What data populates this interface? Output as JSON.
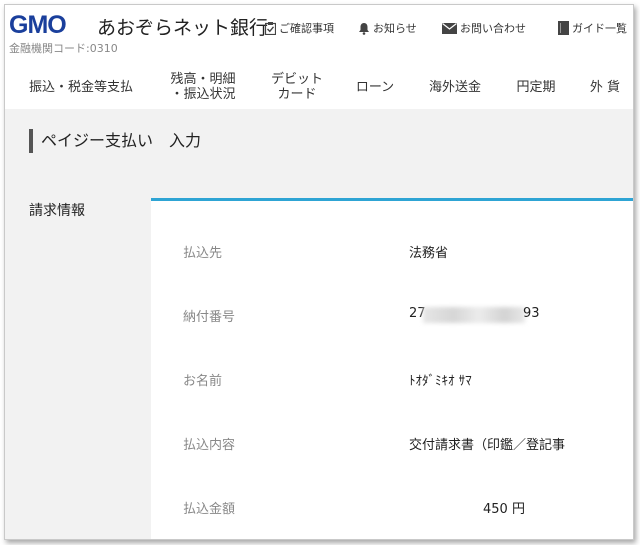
{
  "header": {
    "logo_gmo": "GMO",
    "logo_bank": "あおぞらネット銀行",
    "bank_code": "金融機関コード:0310",
    "utilities": [
      {
        "label": "ご確認事項",
        "icon": "clipboard-check-icon"
      },
      {
        "label": "お知らせ",
        "icon": "bell-icon"
      },
      {
        "label": "お問い合わせ",
        "icon": "mail-icon"
      },
      {
        "label": "ガイド一覧",
        "icon": "book-icon"
      }
    ],
    "brand_color": "#1a3f9c"
  },
  "nav": {
    "items": [
      {
        "label": "振込・税金等支払"
      },
      {
        "label": "残高・明細\n・振込状況"
      },
      {
        "label": "デビット\nカード"
      },
      {
        "label": "ローン"
      },
      {
        "label": "海外送金"
      },
      {
        "label": "円定期"
      },
      {
        "label": "外 貨"
      }
    ]
  },
  "page": {
    "title": "ペイジー支払い　入力",
    "section_label": "請求情報",
    "accent_color": "#2ea4d4"
  },
  "details": {
    "rows": [
      {
        "label": "払込先",
        "value": "法務省"
      },
      {
        "label": "納付番号",
        "value_prefix": "27",
        "value_suffix": "93"
      },
      {
        "label": "お名前",
        "value": "ﾄｵﾀﾞﾐｷｵ ｻﾏ"
      },
      {
        "label": "払込内容",
        "value": "交付請求書（印鑑／登記事"
      },
      {
        "label": "払込金額",
        "value": "450 円"
      }
    ]
  }
}
